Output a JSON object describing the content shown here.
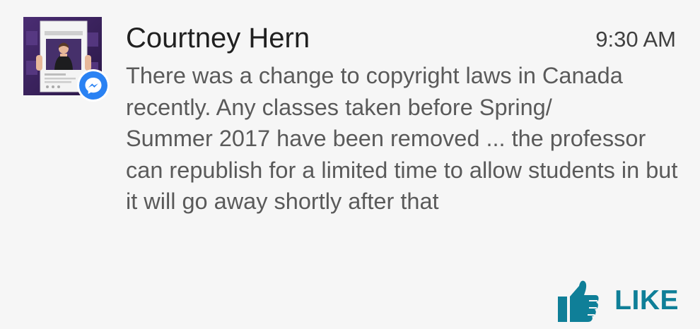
{
  "notification": {
    "sender": "Courtney Hern",
    "time": "9:30 AM",
    "message": "There was a change to copyright laws in Canada recently.  Any classes taken before Spring/\nSummer 2017 have been removed ... the professor can republish for a limited time to allow students in but it will go away shortly after that",
    "app_icon": "messenger-icon",
    "action": {
      "label": "LIKE",
      "icon": "thumbs-up-icon"
    }
  },
  "colors": {
    "background": "#f6f6f6",
    "accent": "#0f7f98",
    "messenger_blue": "#2a82f3",
    "sender_text": "#202020",
    "message_text": "#5a5a5a"
  }
}
